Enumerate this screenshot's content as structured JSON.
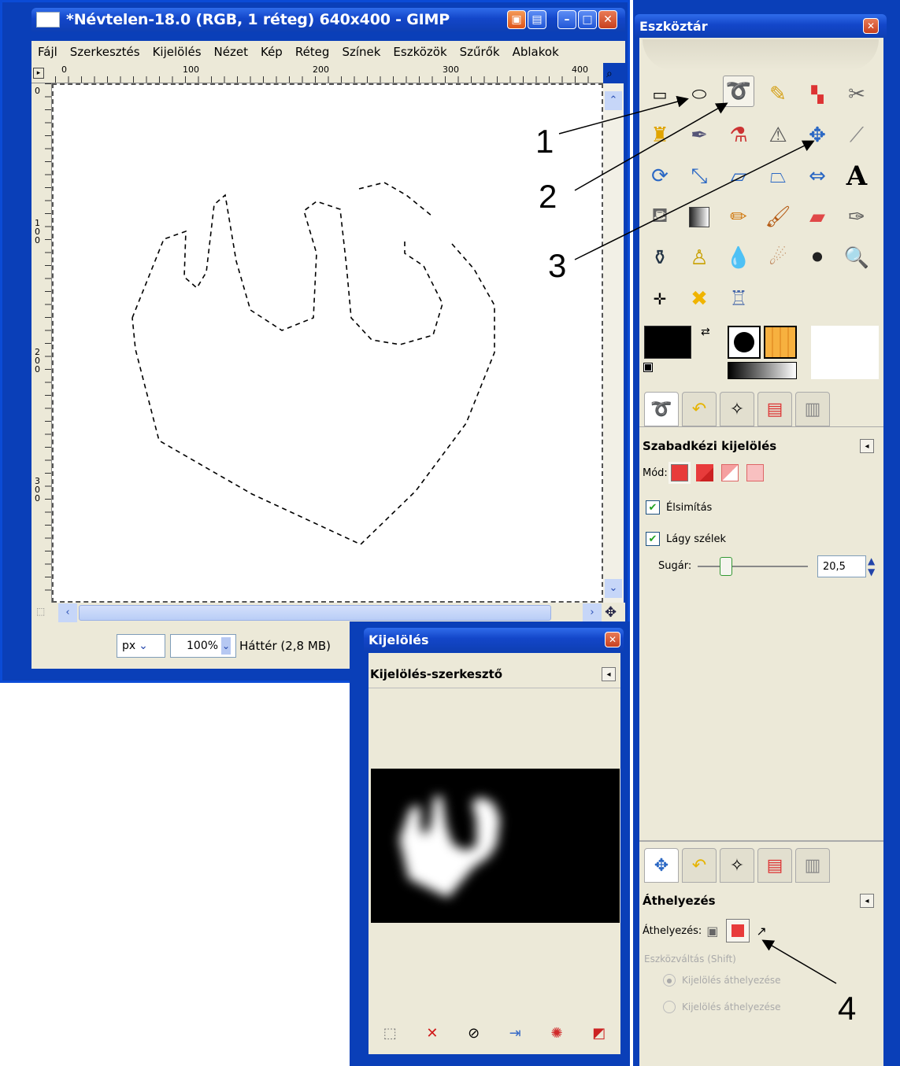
{
  "main_window": {
    "title": "*Névtelen-18.0 (RGB, 1 réteg) 640x400 - GIMP",
    "menu": [
      "Fájl",
      "Szerkesztés",
      "Kijelölés",
      "Nézet",
      "Kép",
      "Réteg",
      "Színek",
      "Eszközök",
      "Szűrők",
      "Ablakok"
    ],
    "ruler_h": [
      "0",
      "100",
      "200",
      "300",
      "400"
    ],
    "ruler_v": [
      "0",
      "1\n0\n0",
      "2\n0\n0",
      "3\n0\n0"
    ],
    "unit": "px",
    "zoom": "100%",
    "status": "Háttér (2,8 MB)"
  },
  "toolbox": {
    "title": "Eszköztár",
    "tool_options": {
      "title": "Szabadkézi kijelölés",
      "mode_label": "Mód:",
      "antialias": "Élsimítás",
      "feather": "Lágy szélek",
      "radius_label": "Sugár:",
      "radius_value": "20,5"
    },
    "move_options": {
      "title": "Áthelyezés",
      "move_label": "Áthelyezés:",
      "toggle_label": "Eszközváltás (Shift)",
      "opt1": "Kijelölés áthelyezése",
      "opt2": "Kijelölés áthelyezése"
    }
  },
  "selection_editor": {
    "title": "Kijelölés",
    "header": "Kijelölés-szerkesztő"
  },
  "callouts": [
    "1",
    "2",
    "3",
    "4"
  ],
  "colors": {
    "accent": "#0a3fb8",
    "panel": "#ece9d8",
    "selection": "#e83b3b"
  }
}
